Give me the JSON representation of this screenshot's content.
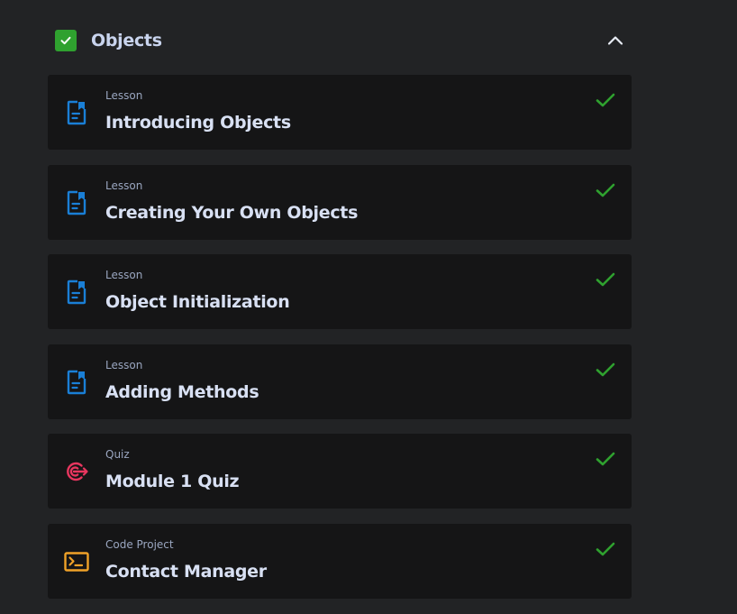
{
  "module": {
    "title": "Objects",
    "completed": true,
    "expanded": true
  },
  "items": [
    {
      "type": "Lesson",
      "title": "Introducing Objects",
      "icon": "lesson-icon",
      "completed": true
    },
    {
      "type": "Lesson",
      "title": "Creating Your Own Objects",
      "icon": "lesson-icon",
      "completed": true
    },
    {
      "type": "Lesson",
      "title": "Object Initialization",
      "icon": "lesson-icon",
      "completed": true
    },
    {
      "type": "Lesson",
      "title": "Adding Methods",
      "icon": "lesson-icon",
      "completed": true
    },
    {
      "type": "Quiz",
      "title": "Module 1 Quiz",
      "icon": "quiz-target-icon",
      "completed": true
    },
    {
      "type": "Code Project",
      "title": "Contact Manager",
      "icon": "terminal-icon",
      "completed": true
    }
  ],
  "colors": {
    "background": "#222325",
    "card": "#151516",
    "check_green": "#2fa12f",
    "lesson_blue": "#1a7fd6",
    "quiz_pink": "#e8365f",
    "project_orange": "#f0a228"
  }
}
